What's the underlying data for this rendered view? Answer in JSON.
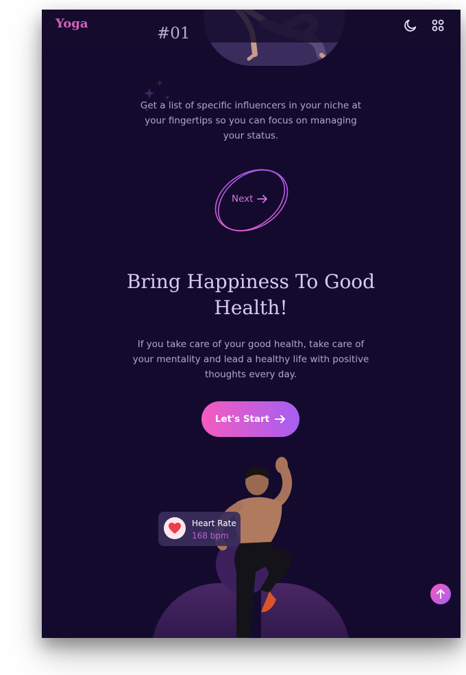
{
  "header": {
    "logo": "Yoga",
    "theme_icon": "moon-icon",
    "menu_icon": "grid-icon"
  },
  "onboarding": {
    "step_number": "#01",
    "intro_text": "Get a list of specific influencers in your niche at your fingertips so you can focus on managing your status.",
    "next_label": "Next"
  },
  "hero": {
    "title": "Bring Happiness To Good Health!",
    "description": "If you take care of your good health, take care of your mentality and lead a healthy life with positive thoughts every day.",
    "cta_label": "Let's Start"
  },
  "heart_rate": {
    "label": "Heart Rate",
    "value": "168 bpm",
    "icon": "heart-icon"
  },
  "scroll_top_icon": "arrow-up-icon",
  "colors": {
    "background": "#140a2e",
    "accent_pink": "#f45bbf",
    "accent_purple": "#a65ff2",
    "logo": "#d65fc0",
    "text_muted": "#b3a8cc",
    "heading": "#d7ccf0"
  }
}
